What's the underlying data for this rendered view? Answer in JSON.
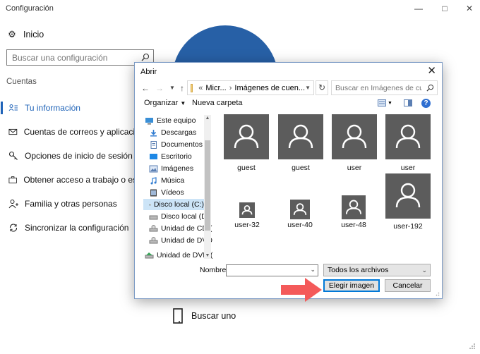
{
  "settings": {
    "title": "Configuración",
    "home_label": "Inicio",
    "search_placeholder": "Buscar una configuración",
    "section": "Cuentas",
    "nav": [
      {
        "label": "Tu información",
        "icon": "person-card-icon",
        "active": true
      },
      {
        "label": "Cuentas de correos y aplicaciones",
        "icon": "mail-icon",
        "active": false
      },
      {
        "label": "Opciones de inicio de sesión",
        "icon": "key-icon",
        "active": false
      },
      {
        "label": "Obtener acceso a trabajo o escuela",
        "icon": "briefcase-icon",
        "active": false
      },
      {
        "label": "Familia y otras personas",
        "icon": "person-add-icon",
        "active": false
      },
      {
        "label": "Sincronizar la configuración",
        "icon": "sync-icon",
        "active": false
      }
    ],
    "browse_label": "Buscar uno",
    "accent_color": "#2760a6"
  },
  "dialog": {
    "title": "Abrir",
    "breadcrumb": [
      "Micr...",
      "Imágenes de cuen..."
    ],
    "search_placeholder": "Buscar en Imágenes de cuent...",
    "organize_label": "Organizar",
    "new_folder_label": "Nueva carpeta",
    "tree": [
      {
        "label": "Este equipo",
        "icon": "computer-icon",
        "selected": false
      },
      {
        "label": "Descargas",
        "icon": "download-icon",
        "selected": false
      },
      {
        "label": "Documentos",
        "icon": "document-icon",
        "selected": false
      },
      {
        "label": "Escritorio",
        "icon": "desktop-icon",
        "selected": false
      },
      {
        "label": "Imágenes",
        "icon": "picture-icon",
        "selected": false
      },
      {
        "label": "Música",
        "icon": "music-icon",
        "selected": false
      },
      {
        "label": "Vídeos",
        "icon": "video-icon",
        "selected": false
      },
      {
        "label": "Disco local (C:)",
        "icon": "drive-icon",
        "selected": true
      },
      {
        "label": "Disco local (D:)",
        "icon": "drive-icon",
        "selected": false
      },
      {
        "label": "Unidad de CD (H",
        "icon": "cd-drive-icon",
        "selected": false
      },
      {
        "label": "Unidad de DVD (",
        "icon": "dvd-drive-icon",
        "selected": false
      },
      {
        "label": "Unidad de DVD (I:",
        "icon": "dvd-drive-icon",
        "selected": false
      }
    ],
    "files": [
      {
        "name": "guest"
      },
      {
        "name": "guest"
      },
      {
        "name": "user"
      },
      {
        "name": "user"
      },
      {
        "name": "user-32"
      },
      {
        "name": "user-40"
      },
      {
        "name": "user-48"
      },
      {
        "name": "user-192"
      }
    ],
    "filename_label": "Nombre:",
    "filename_value": "",
    "filter_value": "Todos los archivos",
    "choose_label": "Elegir imagen",
    "cancel_label": "Cancelar",
    "highlight_color": "#f45a5a"
  }
}
